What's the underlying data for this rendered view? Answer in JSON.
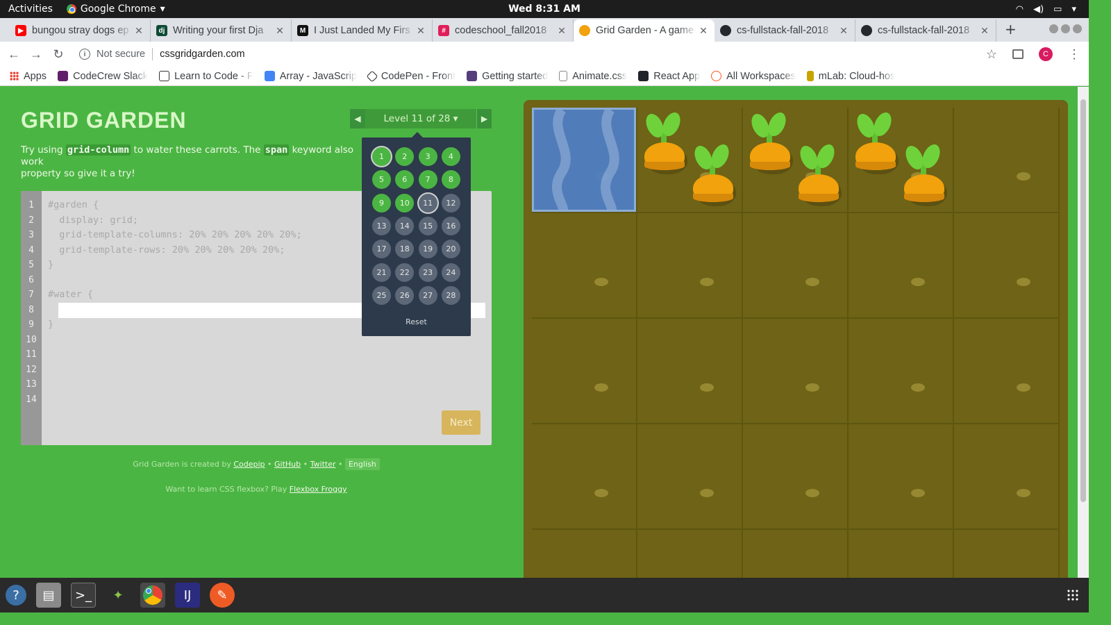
{
  "system_bar": {
    "activities": "Activities",
    "app_name": "Google Chrome",
    "clock": "Wed  8:31 AM"
  },
  "tabs": [
    {
      "title": "bungou stray dogs ep",
      "favicon_color": "#ff0000",
      "favicon_glyph": "▶"
    },
    {
      "title": "Writing your first Dja",
      "favicon_color": "#0c4b33",
      "favicon_glyph": "dj"
    },
    {
      "title": "I Just Landed My Firs",
      "favicon_color": "#111111",
      "favicon_glyph": "M"
    },
    {
      "title": "codeschool_fall2018",
      "favicon_color": "#e01e5a",
      "favicon_glyph": "#"
    },
    {
      "title": "Grid Garden - A game",
      "favicon_color": "#f1a20c",
      "favicon_glyph": "●",
      "active": true
    },
    {
      "title": "cs-fullstack-fall-2018",
      "favicon_color": "#24292e",
      "favicon_glyph": "●"
    },
    {
      "title": "cs-fullstack-fall-2018",
      "favicon_color": "#24292e",
      "favicon_glyph": "●"
    }
  ],
  "omnibox": {
    "security": "Not secure",
    "url": "cssgridgarden.com",
    "profile_initial": "C"
  },
  "bookmarks": [
    {
      "label": "Apps",
      "color": "#ea4335"
    },
    {
      "label": "CodeCrew Slack",
      "color": "#611f69"
    },
    {
      "label": "Learn to Code - F",
      "color": "#333333"
    },
    {
      "label": "Array - JavaScrip",
      "color": "#4285f4"
    },
    {
      "label": "CodePen - Front",
      "color": "#222222"
    },
    {
      "label": "Getting started",
      "color": "#563d7c"
    },
    {
      "label": "Animate.css",
      "color": "#888888"
    },
    {
      "label": "React App",
      "color": "#20232a"
    },
    {
      "label": "All Workspaces",
      "color": "#ff5722"
    },
    {
      "label": "mLab: Cloud-hos",
      "color": "#c8a400"
    }
  ],
  "game": {
    "title": "GRID GARDEN",
    "instruction_parts": [
      "Try using ",
      "grid-column",
      " to water these carrots. The ",
      "span",
      " keyword also work",
      "property so give it a try!"
    ],
    "level_label": "Level 11 of 28 ▾",
    "prev_icon": "◀",
    "next_icon": "▶",
    "next_button": "Next",
    "reset": "Reset",
    "line_numbers": [
      "1",
      "2",
      "3",
      "4",
      "5",
      "6",
      "7",
      "8",
      "9",
      "10",
      "11",
      "12",
      "13",
      "14"
    ],
    "code_lines": [
      "#garden {",
      "  display: grid;",
      "  grid-template-columns: 20% 20% 20% 20% 20%;",
      "  grid-template-rows: 20% 20% 20% 20% 20%;",
      "}",
      "",
      "#water {",
      "",
      "}"
    ],
    "answer_value": "",
    "levels": [
      "1",
      "2",
      "3",
      "4",
      "5",
      "6",
      "7",
      "8",
      "9",
      "10",
      "11",
      "12",
      "13",
      "14",
      "15",
      "16",
      "17",
      "18",
      "19",
      "20",
      "21",
      "22",
      "23",
      "24",
      "25",
      "26",
      "27",
      "28"
    ],
    "completed_levels": 10,
    "current_level": 11,
    "credits_prefix": "Grid Garden is created by",
    "credits_links": [
      "Codepip",
      "GitHub",
      "Twitter"
    ],
    "language": "English",
    "promo_prefix": "Want to learn CSS flexbox? Play",
    "promo_link": "Flexbox Froggy",
    "carrot_columns": [
      2,
      3,
      4
    ]
  },
  "taskbar": [
    "help-icon",
    "files-icon",
    "terminal-icon",
    "android-studio-icon",
    "chrome-icon",
    "intellij-icon",
    "postman-icon"
  ]
}
